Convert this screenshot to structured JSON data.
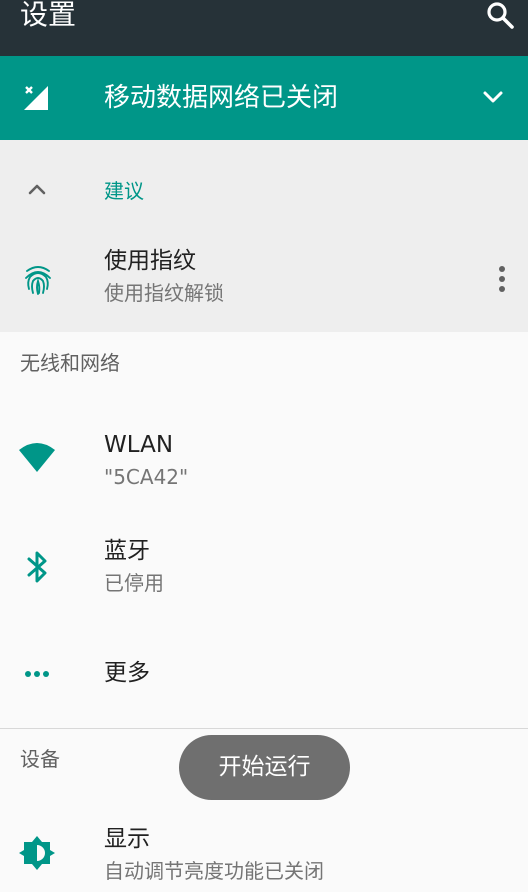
{
  "appbar": {
    "title": "设置",
    "search_icon": "search-icon"
  },
  "banner": {
    "title": "移动数据网络已关闭",
    "icon": "mobile-data-off-icon",
    "expand_icon": "chevron-down-icon"
  },
  "suggestions": {
    "header_label": "建议",
    "items": [
      {
        "title": "使用指纹",
        "subtitle": "使用指纹解锁",
        "icon": "fingerprint-icon"
      }
    ]
  },
  "categories": [
    {
      "title": "无线和网络",
      "items": [
        {
          "title": "WLAN",
          "subtitle": "\"5CA42\"",
          "icon": "wifi-icon"
        },
        {
          "title": "蓝牙",
          "subtitle": "已停用",
          "icon": "bluetooth-icon"
        },
        {
          "title": "更多",
          "icon": "more-horiz-icon"
        }
      ]
    },
    {
      "title": "设备",
      "items": [
        {
          "title": "显示",
          "subtitle": "自动调节亮度功能已关闭",
          "icon": "brightness-icon"
        }
      ]
    }
  ],
  "toast": {
    "text": "开始运行"
  },
  "colors": {
    "appbar": "#263238",
    "accent": "#009688",
    "suggestion_bg": "#eeeeee",
    "background": "#fafafa"
  }
}
